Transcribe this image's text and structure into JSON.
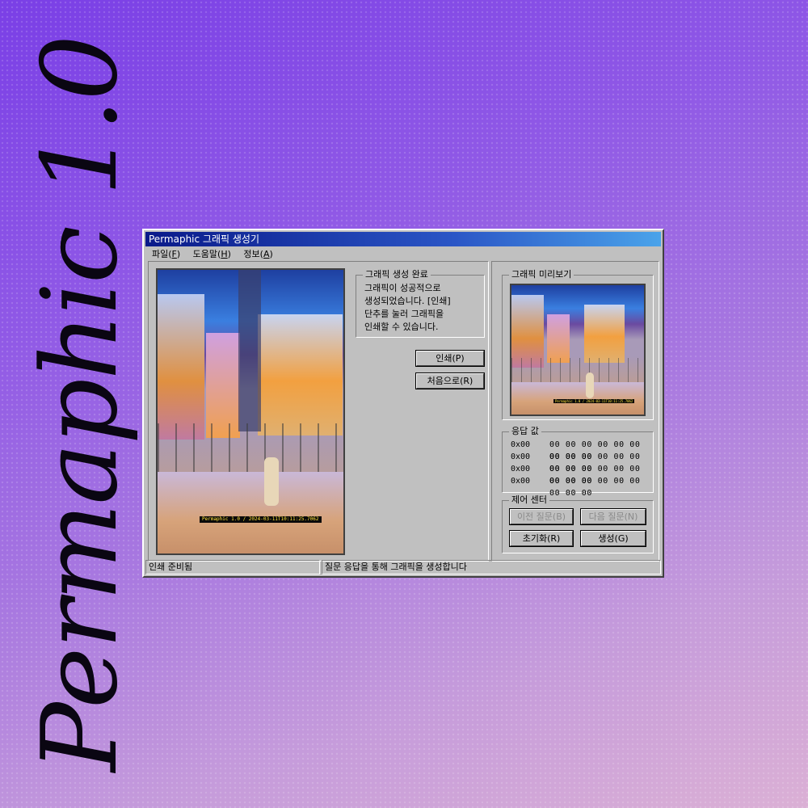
{
  "side_title": "Permaphic 1.0",
  "window": {
    "title": "Permaphic 그래픽 생성기",
    "menu": [
      {
        "label": "파일",
        "key": "F"
      },
      {
        "label": "도움말",
        "key": "H"
      },
      {
        "label": "정보",
        "key": "A"
      }
    ]
  },
  "photo": {
    "stamp": "Permaphic 1.0 / 2024-03-11T10:11:25.7062"
  },
  "complete_box": {
    "legend": "그래픽 생성 완료",
    "lines": [
      "그래픽이 성공적으로",
      "생성되었습니다. [인쇄]",
      "단추를 눌러 그래픽을",
      "인쇄할 수 있습니다."
    ]
  },
  "buttons": {
    "print": "인쇄(P)",
    "restart": "처음으로(R)"
  },
  "preview": {
    "legend": "그래픽 미리보기"
  },
  "response": {
    "legend": "응답 값",
    "rows": [
      {
        "addr": "0x00",
        "values": "00 00 00 00 00 00 00 00 00"
      },
      {
        "addr": "0x00",
        "values": "00 00 00 00 00 00 00 00 00"
      },
      {
        "addr": "0x00",
        "values": "00 00 00 00 00 00 00 00 00"
      },
      {
        "addr": "0x00",
        "values": "00 00 00 00 00 00 00 00 00"
      }
    ]
  },
  "control": {
    "legend": "제어 센터",
    "prev": "이전 질문(B)",
    "next": "다음 질문(N)",
    "reset": "초기화(R)",
    "generate": "생성(G)"
  },
  "status": {
    "left": "인쇄 준비됨",
    "right": "질문 응답을 통해 그래픽을 생성합니다"
  }
}
